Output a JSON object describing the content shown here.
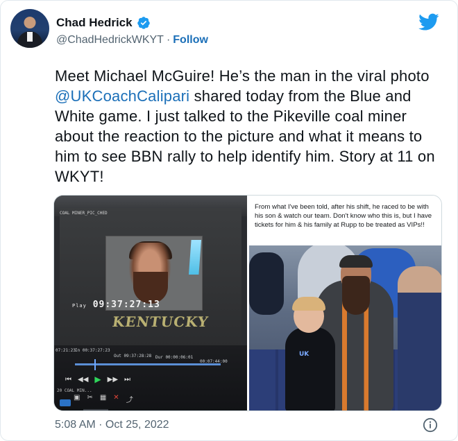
{
  "author": {
    "display_name": "Chad Hedrick",
    "handle": "@ChadHedrickWKYT",
    "separator": "·",
    "follow_label": "Follow",
    "verified": true
  },
  "icons": {
    "verified": "verified-badge-icon",
    "logo": "twitter-bird-icon",
    "info": "info-icon"
  },
  "tweet": {
    "text_before_mention": "Meet Michael McGuire! He’s the man in the viral photo ",
    "mention": "@UKCoachCalipari",
    "text_after_mention": " shared today from the Blue and White game. I just talked to the Pikeville coal miner about the reaction to the picture and what it means to him to see BBN rally to help identify him. Story at 11 on WKYT!"
  },
  "media": {
    "left_image": {
      "clip_label": "COAL MINER_PIC_CHED",
      "timecode_main": "09:37:27:13",
      "timecode_prefix": "Play",
      "overlay_text": "KENTUCKY",
      "timeline_codes": [
        "07:21:23",
        "In 00:37:27:23",
        "Out 09:37:28:28",
        "Dur 00:00:06:01",
        "00:07:44:00"
      ],
      "sequence_label": "20 COAL MIN..."
    },
    "right_image": {
      "caption": "From what I've been told, after his shift, he raced to be with his son & watch our team. Don't know who this is, but I have tickets for him & his family at Rupp to be treated as VIPs!!",
      "shirt_text": "UK"
    }
  },
  "footer": {
    "timestamp": "5:08 AM · Oct 25, 2022"
  },
  "colors": {
    "link": "#1b6fb8",
    "twitter_blue": "#1d9bf0",
    "secondary_text": "#536471",
    "border": "#cfd9de"
  }
}
